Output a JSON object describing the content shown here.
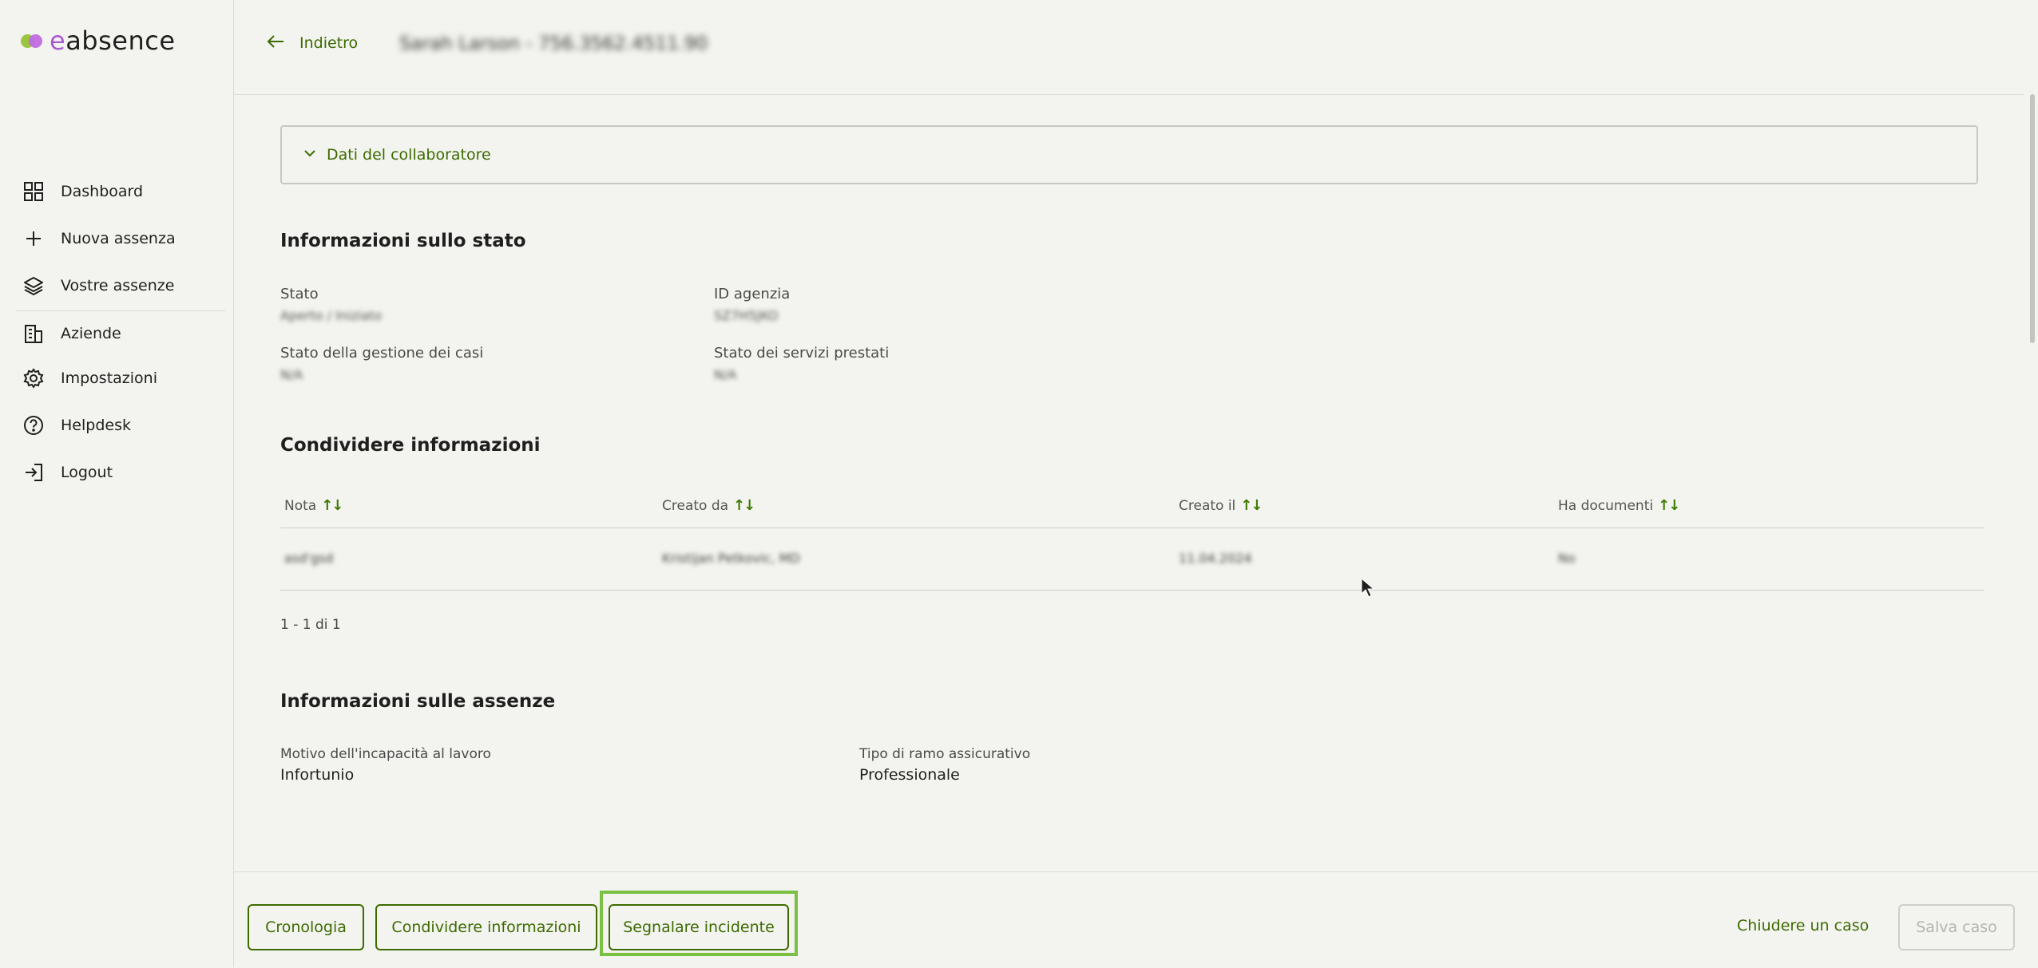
{
  "app": {
    "logo_e": "e",
    "logo_rest": "absence"
  },
  "sidebar": {
    "items": [
      {
        "label": "Dashboard",
        "icon": "grid-icon"
      },
      {
        "label": "Nuova assenza",
        "icon": "plus-icon"
      },
      {
        "label": "Vostre assenze",
        "icon": "layers-icon"
      },
      {
        "label": "Aziende",
        "icon": "building-icon"
      },
      {
        "label": "Impostazioni",
        "icon": "gear-icon"
      },
      {
        "label": "Helpdesk",
        "icon": "help-circle-icon"
      },
      {
        "label": "Logout",
        "icon": "logout-icon"
      }
    ]
  },
  "header": {
    "back_label": "Indietro",
    "case_title": "Sarah Larson - 756.3562.4511.90"
  },
  "collapsible": {
    "label": "Dati del collaboratore"
  },
  "status_section": {
    "title": "Informazioni sullo stato",
    "fields": [
      {
        "label": "Stato",
        "value": "Aperto / Iniziato"
      },
      {
        "label": "ID agenzia",
        "value": "SZ7H5JKO"
      },
      {
        "label": "Stato della gestione dei casi",
        "value": "N/A"
      },
      {
        "label": "Stato dei servizi prestati",
        "value": "N/A"
      }
    ]
  },
  "share_section": {
    "title": "Condividere informazioni",
    "columns": [
      "Nota",
      "Creato da",
      "Creato il",
      "Ha documenti"
    ],
    "rows": [
      [
        "asd'gsd",
        "Kristijan Petkovic, MD",
        "11.04.2024",
        "No"
      ]
    ],
    "pagination": "1 - 1 di 1"
  },
  "absence_section": {
    "title": "Informazioni sulle assenze",
    "fields": [
      {
        "label": "Motivo dell'incapacità al lavoro",
        "value": "Infortunio"
      },
      {
        "label": "Tipo di ramo assicurativo",
        "value": "Professionale"
      }
    ]
  },
  "footer": {
    "history": "Cronologia",
    "share": "Condividere informazioni",
    "report": "Segnalare incidente",
    "close": "Chiudere un caso",
    "save": "Salva caso"
  },
  "colors": {
    "accent": "#3d6b00",
    "highlight": "#7ac143",
    "background": "#f3f3ef"
  }
}
